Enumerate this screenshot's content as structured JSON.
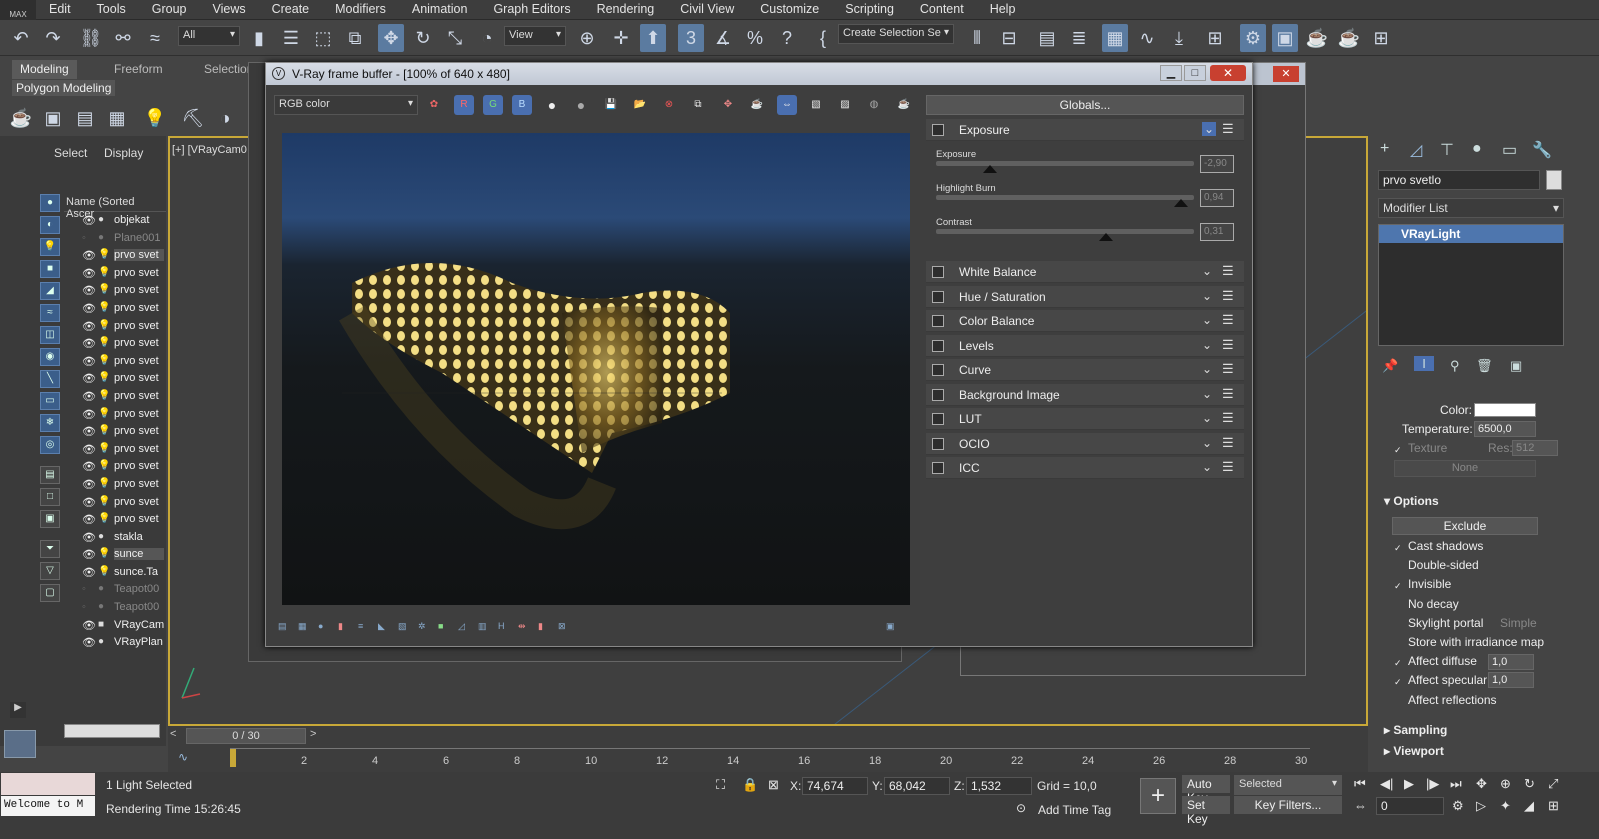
{
  "menubar": {
    "logo": "MAX",
    "items": [
      "Edit",
      "Tools",
      "Group",
      "Views",
      "Create",
      "Modifiers",
      "Animation",
      "Graph Editors",
      "Rendering",
      "Civil View",
      "Customize",
      "Scripting",
      "Content",
      "Help"
    ]
  },
  "toolbar": {
    "selection_filter": "All",
    "ref_coord": "View",
    "selection_set": "Create Selection Se"
  },
  "ribbon": {
    "tabs": [
      "Modeling",
      "Freeform",
      "Selection"
    ],
    "subtitle": "Polygon Modeling"
  },
  "scene_explorer": {
    "tabs": [
      "Select",
      "Display"
    ],
    "column_header": "Name (Sorted Ascer",
    "rows": [
      {
        "name": "objekat",
        "icon": "eye",
        "type": "geo",
        "dim": false,
        "selected": false
      },
      {
        "name": "Plane001",
        "icon": "none",
        "type": "geo",
        "dim": true,
        "selected": false
      },
      {
        "name": "prvo svet",
        "icon": "eye",
        "type": "light",
        "dim": false,
        "selected": true
      },
      {
        "name": "prvo svet",
        "icon": "eye",
        "type": "light",
        "dim": false,
        "selected": false
      },
      {
        "name": "prvo svet",
        "icon": "eye",
        "type": "light",
        "dim": false,
        "selected": false
      },
      {
        "name": "prvo svet",
        "icon": "eye",
        "type": "light",
        "dim": false,
        "selected": false
      },
      {
        "name": "prvo svet",
        "icon": "eye",
        "type": "light",
        "dim": false,
        "selected": false
      },
      {
        "name": "prvo svet",
        "icon": "eye",
        "type": "light",
        "dim": false,
        "selected": false
      },
      {
        "name": "prvo svet",
        "icon": "eye",
        "type": "light",
        "dim": false,
        "selected": false
      },
      {
        "name": "prvo svet",
        "icon": "eye",
        "type": "light",
        "dim": false,
        "selected": false
      },
      {
        "name": "prvo svet",
        "icon": "eye",
        "type": "light",
        "dim": false,
        "selected": false
      },
      {
        "name": "prvo svet",
        "icon": "eye",
        "type": "light",
        "dim": false,
        "selected": false
      },
      {
        "name": "prvo svet",
        "icon": "eye",
        "type": "light",
        "dim": false,
        "selected": false
      },
      {
        "name": "prvo svet",
        "icon": "eye",
        "type": "light",
        "dim": false,
        "selected": false
      },
      {
        "name": "prvo svet",
        "icon": "eye",
        "type": "light",
        "dim": false,
        "selected": false
      },
      {
        "name": "prvo svet",
        "icon": "eye",
        "type": "light",
        "dim": false,
        "selected": false
      },
      {
        "name": "prvo svet",
        "icon": "eye",
        "type": "light",
        "dim": false,
        "selected": false
      },
      {
        "name": "prvo svet",
        "icon": "eye",
        "type": "light",
        "dim": false,
        "selected": false
      },
      {
        "name": "stakla",
        "icon": "eye",
        "type": "geo",
        "dim": false,
        "selected": false
      },
      {
        "name": "sunce",
        "icon": "eye",
        "type": "light",
        "dim": false,
        "selected": true
      },
      {
        "name": "sunce.Ta",
        "icon": "eye",
        "type": "light",
        "dim": false,
        "selected": false
      },
      {
        "name": "Teapot00",
        "icon": "none",
        "type": "geo",
        "dim": true,
        "selected": false
      },
      {
        "name": "Teapot00",
        "icon": "none",
        "type": "geo",
        "dim": true,
        "selected": false
      },
      {
        "name": "VRayCam",
        "icon": "eye",
        "type": "camera",
        "dim": false,
        "selected": false
      },
      {
        "name": "VRayPlan",
        "icon": "eye",
        "type": "geo",
        "dim": false,
        "selected": false
      }
    ]
  },
  "viewport": {
    "label": "[+] [VRayCam0"
  },
  "vfb": {
    "title": "V-Ray frame buffer - [100% of 640 x 480]",
    "channel": "RGB color",
    "channel_buttons": [
      "R",
      "G",
      "B"
    ],
    "globals_label": "Globals...",
    "exposure_section": "Exposure",
    "sliders": [
      {
        "label": "Exposure",
        "value": "-2,90",
        "pos": 0.21
      },
      {
        "label": "Highlight Burn",
        "value": "0,94",
        "pos": 0.95
      },
      {
        "label": "Contrast",
        "value": "0,31",
        "pos": 0.66
      }
    ],
    "sections": [
      "White Balance",
      "Hue / Saturation",
      "Color Balance",
      "Levels",
      "Curve",
      "Background Image",
      "LUT",
      "OCIO",
      "ICC"
    ]
  },
  "command_panel": {
    "object_name": "prvo svetlo",
    "modifier_list": "Modifier List",
    "stack_item": "VRayLight",
    "color_label": "Color:",
    "temperature_label": "Temperature:",
    "temperature_value": "6500,0",
    "texture_label": "Texture",
    "res_label": "Res:",
    "res_value": "512",
    "none_label": "None",
    "options_head": "Options",
    "exclude_label": "Exclude",
    "options": [
      {
        "label": "Cast shadows",
        "checked": true
      },
      {
        "label": "Double-sided",
        "checked": false
      },
      {
        "label": "Invisible",
        "checked": true
      },
      {
        "label": "No decay",
        "checked": false
      },
      {
        "label": "Skylight portal",
        "checked": false
      },
      {
        "label": "Store with irradiance map",
        "checked": false
      },
      {
        "label": "Affect diffuse",
        "checked": true
      },
      {
        "label": "Affect specular",
        "checked": true
      },
      {
        "label": "Affect reflections",
        "checked": false
      }
    ],
    "simple_label": "Simple",
    "affect_diffuse_value": "1,0",
    "affect_specular_value": "1,0",
    "sampling_head": "Sampling",
    "viewport_head": "Viewport"
  },
  "timeline": {
    "frame": "0 / 30",
    "ticks": [
      "0",
      "2",
      "4",
      "6",
      "8",
      "10",
      "12",
      "14",
      "16",
      "18",
      "20",
      "22",
      "24",
      "26",
      "28",
      "30"
    ]
  },
  "status": {
    "selected": "1 Light Selected",
    "render_time": "Rendering Time 15:26:45",
    "welcome": "Welcome to M",
    "x_label": "X:",
    "x_value": "74,674",
    "y_label": "Y:",
    "y_value": "68,042",
    "z_label": "Z:",
    "z_value": "1,532",
    "grid": "Grid = 10,0",
    "add_time_tag": "Add Time Tag",
    "auto_key": "Auto Key",
    "set_key": "Set Key",
    "selected_dd": "Selected",
    "key_filters": "Key Filters...",
    "frame_field": "0"
  }
}
